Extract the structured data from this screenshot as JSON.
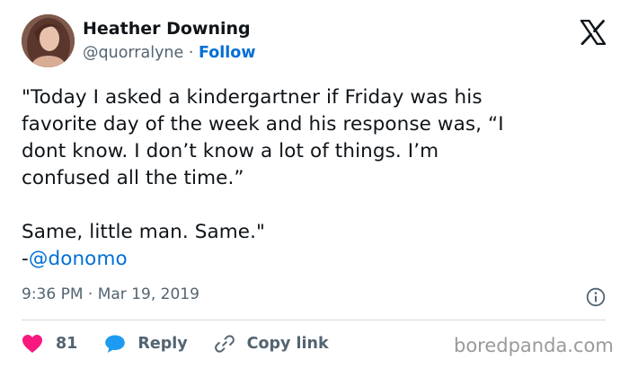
{
  "author": {
    "name": "Heather Downing",
    "handle": "@quorralyne",
    "separator": "·",
    "follow_label": "Follow"
  },
  "tweet": {
    "paragraph1": "\"Today I asked a kindergartner if Friday was his\nfavorite day of the week and his response was, “I\ndont know. I don’t know a lot of things. I’m\nconfused all the time.”",
    "paragraph2": "Same, little man. Same.\"",
    "attribution_prefix": "-",
    "mention": "@donomo",
    "time": "9:36 PM",
    "time_separator": "·",
    "date": "Mar 19, 2019"
  },
  "actions": {
    "like_count": "81",
    "reply_label": "Reply",
    "copy_link_label": "Copy link"
  },
  "icons": {
    "platform": "x-logo-icon",
    "info": "info-icon",
    "like": "heart-icon",
    "reply": "speech-bubble-icon",
    "copy_link": "link-icon"
  },
  "colors": {
    "accent": "#006fd6",
    "like": "#f91880",
    "muted": "#536471",
    "text": "#0f1419",
    "watermark": "#9a9a9a"
  },
  "watermark": "boredpanda.com"
}
